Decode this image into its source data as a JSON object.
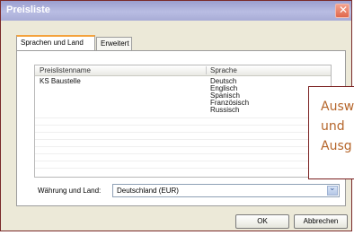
{
  "window": {
    "title": "Preisliste",
    "close_icon": "close-icon"
  },
  "tabs": [
    {
      "label": "Sprachen und Land"
    },
    {
      "label": "Erweitert"
    }
  ],
  "list": {
    "headers": {
      "name": "Preislistenname",
      "language": "Sprache"
    },
    "name": "KS Baustelle",
    "languages": [
      "Deutsch",
      "Englisch",
      "Spanisch",
      "Französisch",
      "Russisch"
    ]
  },
  "currency": {
    "label": "Währung und Land:",
    "value": "Deutschland (EUR)",
    "dropdown_icon": "chevron-down-icon"
  },
  "buttons": {
    "ok": "OK",
    "cancel": "Abbrechen"
  },
  "callout": {
    "lines": [
      "Ausw",
      "und",
      "Ausg"
    ]
  }
}
